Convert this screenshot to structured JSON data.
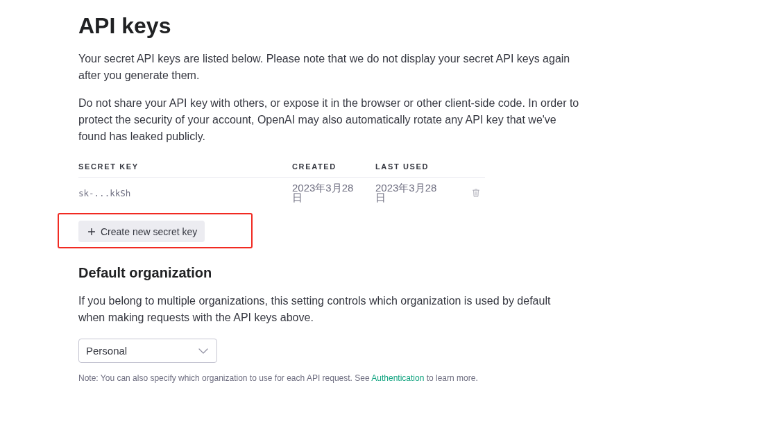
{
  "page": {
    "title": "API keys",
    "paragraphs": [
      "Your secret API keys are listed below. Please note that we do not display your secret API keys again after you generate them.",
      "Do not share your API key with others, or expose it in the browser or other client-side code. In order to protect the security of your account, OpenAI may also automatically rotate any API key that we've found has leaked publicly."
    ]
  },
  "keys_table": {
    "columns": [
      "SECRET KEY",
      "CREATED",
      "LAST USED"
    ],
    "rows": [
      {
        "secret_key": "sk-...kkSh",
        "created": "2023年3月28日",
        "last_used": "2023年3月28日"
      }
    ]
  },
  "create_button": {
    "label": "Create new secret key",
    "highlighted": true
  },
  "default_organization": {
    "heading": "Default organization",
    "description": "If you belong to multiple organizations, this setting controls which organization is used by default when making requests with the API keys above.",
    "select": {
      "value": "Personal"
    },
    "note": {
      "before": "Note: You can also specify which organization to use for each API request. See ",
      "link": "Authentication",
      "after": " to learn more."
    }
  }
}
